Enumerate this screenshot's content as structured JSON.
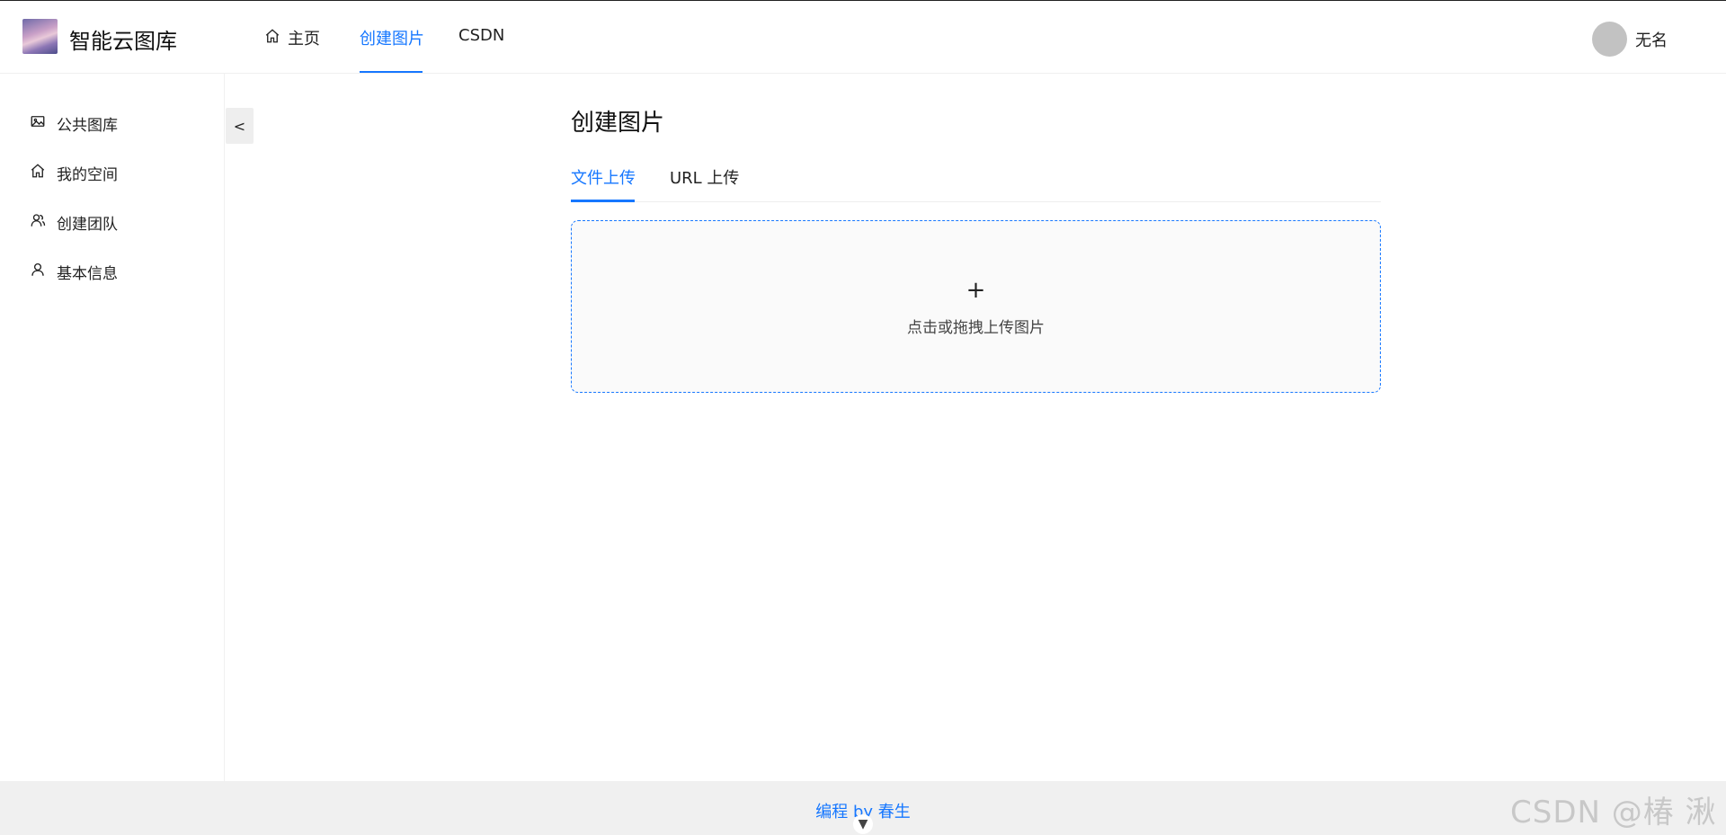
{
  "header": {
    "logo_text": "智能云图库",
    "nav": [
      {
        "label": "主页",
        "icon": "home-icon"
      },
      {
        "label": "创建图片"
      },
      {
        "label": "CSDN"
      }
    ],
    "active_nav": "创建图片",
    "user_name": "无名",
    "accent_color": "#1677ff"
  },
  "sidebar": {
    "items": [
      {
        "label": "公共图库",
        "icon": "image-icon"
      },
      {
        "label": "我的空间",
        "icon": "home-icon"
      },
      {
        "label": "创建团队",
        "icon": "team-icon"
      },
      {
        "label": "基本信息",
        "icon": "user-icon"
      }
    ],
    "collapse_label": "<"
  },
  "main": {
    "title": "创建图片",
    "tabs": [
      {
        "label": "文件上传"
      },
      {
        "label": "URL 上传"
      }
    ],
    "active_tab": "文件上传",
    "upload": {
      "plus": "+",
      "hint": "点击或拖拽上传图片"
    }
  },
  "footer": {
    "text": "编程 by 春生"
  },
  "watermark": "CSDN @椿  湫"
}
